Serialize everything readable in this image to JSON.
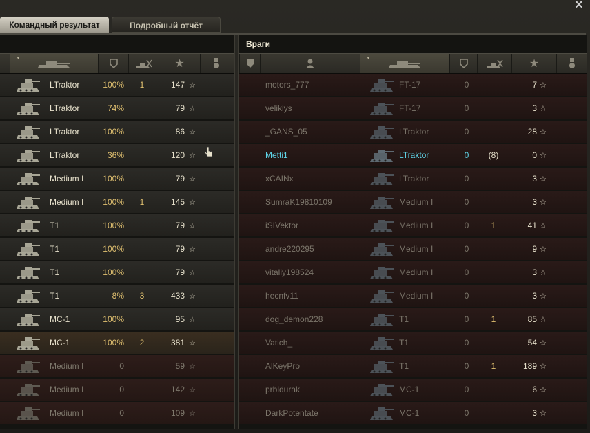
{
  "tabs": {
    "team_result": "Командный результат",
    "detailed_report": "Подробный отчёт"
  },
  "enemies_title": "Враги",
  "colors": {
    "highlight": "#5fd4e8",
    "accent_gold": "#e0c070"
  },
  "header_icons": {
    "tank": "tank-silhouette-icon",
    "hp": "shield-icon",
    "kills": "kills-icon",
    "xp": "star-icon",
    "medal": "medal-icon",
    "squad": "squad-icon",
    "player": "player-icon"
  },
  "team_rows": [
    {
      "vehicle": "LTraktor",
      "hp": "100%",
      "kills": "1",
      "xp": "147",
      "state": "alive"
    },
    {
      "vehicle": "LTraktor",
      "hp": "74%",
      "kills": "",
      "xp": "79",
      "state": "alive"
    },
    {
      "vehicle": "LTraktor",
      "hp": "100%",
      "kills": "",
      "xp": "86",
      "state": "alive"
    },
    {
      "vehicle": "LTraktor",
      "hp": "36%",
      "kills": "",
      "xp": "120",
      "state": "alive"
    },
    {
      "vehicle": "Medium I",
      "hp": "100%",
      "kills": "",
      "xp": "79",
      "state": "alive"
    },
    {
      "vehicle": "Medium I",
      "hp": "100%",
      "kills": "1",
      "xp": "145",
      "state": "alive"
    },
    {
      "vehicle": "T1",
      "hp": "100%",
      "kills": "",
      "xp": "79",
      "state": "alive"
    },
    {
      "vehicle": "T1",
      "hp": "100%",
      "kills": "",
      "xp": "79",
      "state": "alive"
    },
    {
      "vehicle": "T1",
      "hp": "100%",
      "kills": "",
      "xp": "79",
      "state": "alive"
    },
    {
      "vehicle": "T1",
      "hp": "8%",
      "kills": "3",
      "xp": "433",
      "state": "alive"
    },
    {
      "vehicle": "MC-1",
      "hp": "100%",
      "kills": "",
      "xp": "95",
      "state": "alive"
    },
    {
      "vehicle": "MC-1",
      "hp": "100%",
      "kills": "2",
      "xp": "381",
      "state": "me"
    },
    {
      "vehicle": "Medium I",
      "hp": "0",
      "kills": "",
      "xp": "59",
      "state": "dead"
    },
    {
      "vehicle": "Medium I",
      "hp": "0",
      "kills": "",
      "xp": "142",
      "state": "dead"
    },
    {
      "vehicle": "Medium I",
      "hp": "0",
      "kills": "",
      "xp": "109",
      "state": "dead"
    }
  ],
  "enemy_rows": [
    {
      "player": "motors_777",
      "vehicle": "FT-17",
      "hp": "0",
      "kills": "",
      "xp": "7",
      "highlight": false
    },
    {
      "player": "velikiys",
      "vehicle": "FT-17",
      "hp": "0",
      "kills": "",
      "xp": "3",
      "highlight": false
    },
    {
      "player": "_GANS_05",
      "vehicle": "LTraktor",
      "hp": "0",
      "kills": "",
      "xp": "28",
      "highlight": false
    },
    {
      "player": "Metti1",
      "vehicle": "LTraktor",
      "hp": "0",
      "kills": "(8)",
      "xp": "0",
      "highlight": true
    },
    {
      "player": "xCAINx",
      "vehicle": "LTraktor",
      "hp": "0",
      "kills": "",
      "xp": "3",
      "highlight": false
    },
    {
      "player": "SumraK19810109",
      "vehicle": "Medium I",
      "hp": "0",
      "kills": "",
      "xp": "3",
      "highlight": false
    },
    {
      "player": "iSIVektor",
      "vehicle": "Medium I",
      "hp": "0",
      "kills": "1",
      "xp": "41",
      "highlight": false
    },
    {
      "player": "andre220295",
      "vehicle": "Medium I",
      "hp": "0",
      "kills": "",
      "xp": "9",
      "highlight": false
    },
    {
      "player": "vitaliy198524",
      "vehicle": "Medium I",
      "hp": "0",
      "kills": "",
      "xp": "3",
      "highlight": false
    },
    {
      "player": "hecnfv11",
      "vehicle": "Medium I",
      "hp": "0",
      "kills": "",
      "xp": "3",
      "highlight": false
    },
    {
      "player": "dog_demon228",
      "vehicle": "T1",
      "hp": "0",
      "kills": "1",
      "xp": "85",
      "highlight": false
    },
    {
      "player": "Vatich_",
      "vehicle": "T1",
      "hp": "0",
      "kills": "",
      "xp": "54",
      "highlight": false
    },
    {
      "player": "AlKeyPro",
      "vehicle": "T1",
      "hp": "0",
      "kills": "1",
      "xp": "189",
      "highlight": false
    },
    {
      "player": "prbldurak",
      "vehicle": "MC-1",
      "hp": "0",
      "kills": "",
      "xp": "6",
      "highlight": false
    },
    {
      "player": "DarkPotentate",
      "vehicle": "MC-1",
      "hp": "0",
      "kills": "",
      "xp": "3",
      "highlight": false
    }
  ]
}
